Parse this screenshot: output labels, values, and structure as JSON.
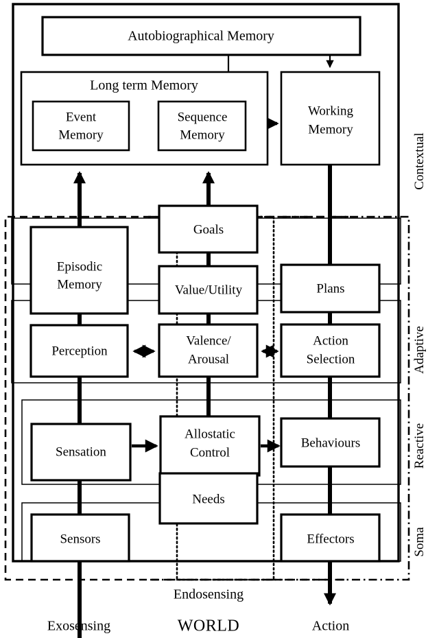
{
  "diagram": {
    "title": "Cognitive architecture layered block diagram",
    "boxes": {
      "autobiographical_memory": "Autobiographical Memory",
      "long_term_memory": "Long term Memory",
      "event_memory_line1": "Event",
      "event_memory_line2": "Memory",
      "sequence_memory_line1": "Sequence",
      "sequence_memory_line2": "Memory",
      "working_memory_line1": "Working",
      "working_memory_line2": "Memory",
      "episodic_memory_line1": "Episodic",
      "episodic_memory_line2": "Memory",
      "goals": "Goals",
      "plans": "Plans",
      "value_utility": "Value/Utility",
      "perception": "Perception",
      "valence_arousal_line1": "Valence/",
      "valence_arousal_line2": "Arousal",
      "action_selection_line1": "Action",
      "action_selection_line2": "Selection",
      "sensation": "Sensation",
      "allostatic_control_line1": "Allostatic",
      "allostatic_control_line2": "Control",
      "behaviours": "Behaviours",
      "needs": "Needs",
      "sensors": "Sensors",
      "effectors": "Effectors"
    },
    "layer_labels": {
      "contextual": "Contextual",
      "adaptive": "Adaptive",
      "reactive": "Reactive",
      "soma": "Soma"
    },
    "bottom_labels": {
      "exosensing": "Exosensing",
      "endosensing": "Endosensing",
      "world": "WORLD",
      "action": "Action"
    },
    "colors": {
      "stroke": "#000000",
      "fill": "#ffffff",
      "background": "#ffffff"
    }
  }
}
